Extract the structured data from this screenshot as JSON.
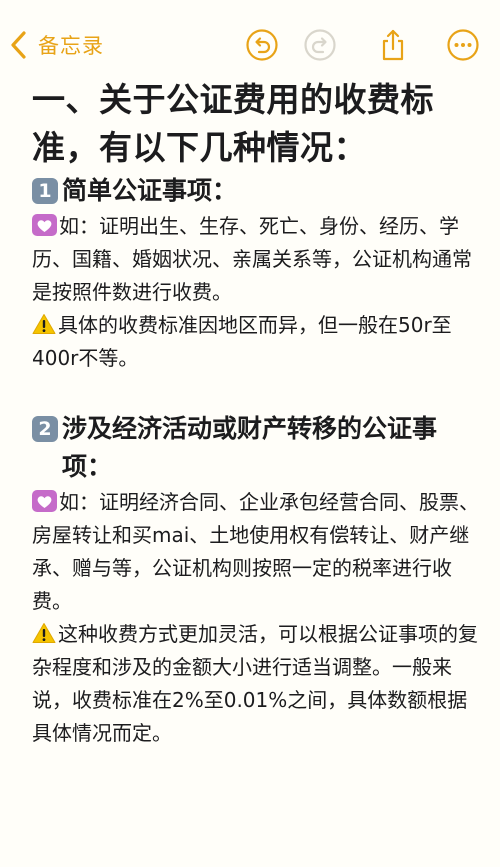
{
  "nav": {
    "back_label": "备忘录",
    "accent": "#e8a317"
  },
  "content": {
    "title": "一、关于公证费用的收费标准，有以下几种情况：",
    "sections": [
      {
        "number": "1",
        "heading": "简单公证事项：",
        "example": "如：证明出生、生存、死亡、身份、经历、学历、国籍、婚姻状况、亲属关系等，公证机构通常是按照件数进行收费。",
        "note": "具体的收费标准因地区而异，但一般在50r至400r不等。"
      },
      {
        "number": "2",
        "heading": "涉及经济活动或财产转移的公证事项：",
        "example": "如：证明经济合同、企业承包经营合同、股票、房屋转让和买mai、土地使用权有偿转让、财产继承、赠与等，公证机构则按照一定的税率进行收费。",
        "note": "这种收费方式更加灵活，可以根据公证事项的复杂程度和涉及的金额大小进行适当调整。一般来说，收费标准在2%至0.01%之间，具体数额根据具体情况而定。"
      }
    ]
  },
  "icons": {
    "back": "chevron-left-icon",
    "undo": "undo-icon",
    "redo": "redo-icon",
    "share": "share-icon",
    "more": "more-icon",
    "example_marker": "heart-icon",
    "note_marker": "warning-icon"
  }
}
